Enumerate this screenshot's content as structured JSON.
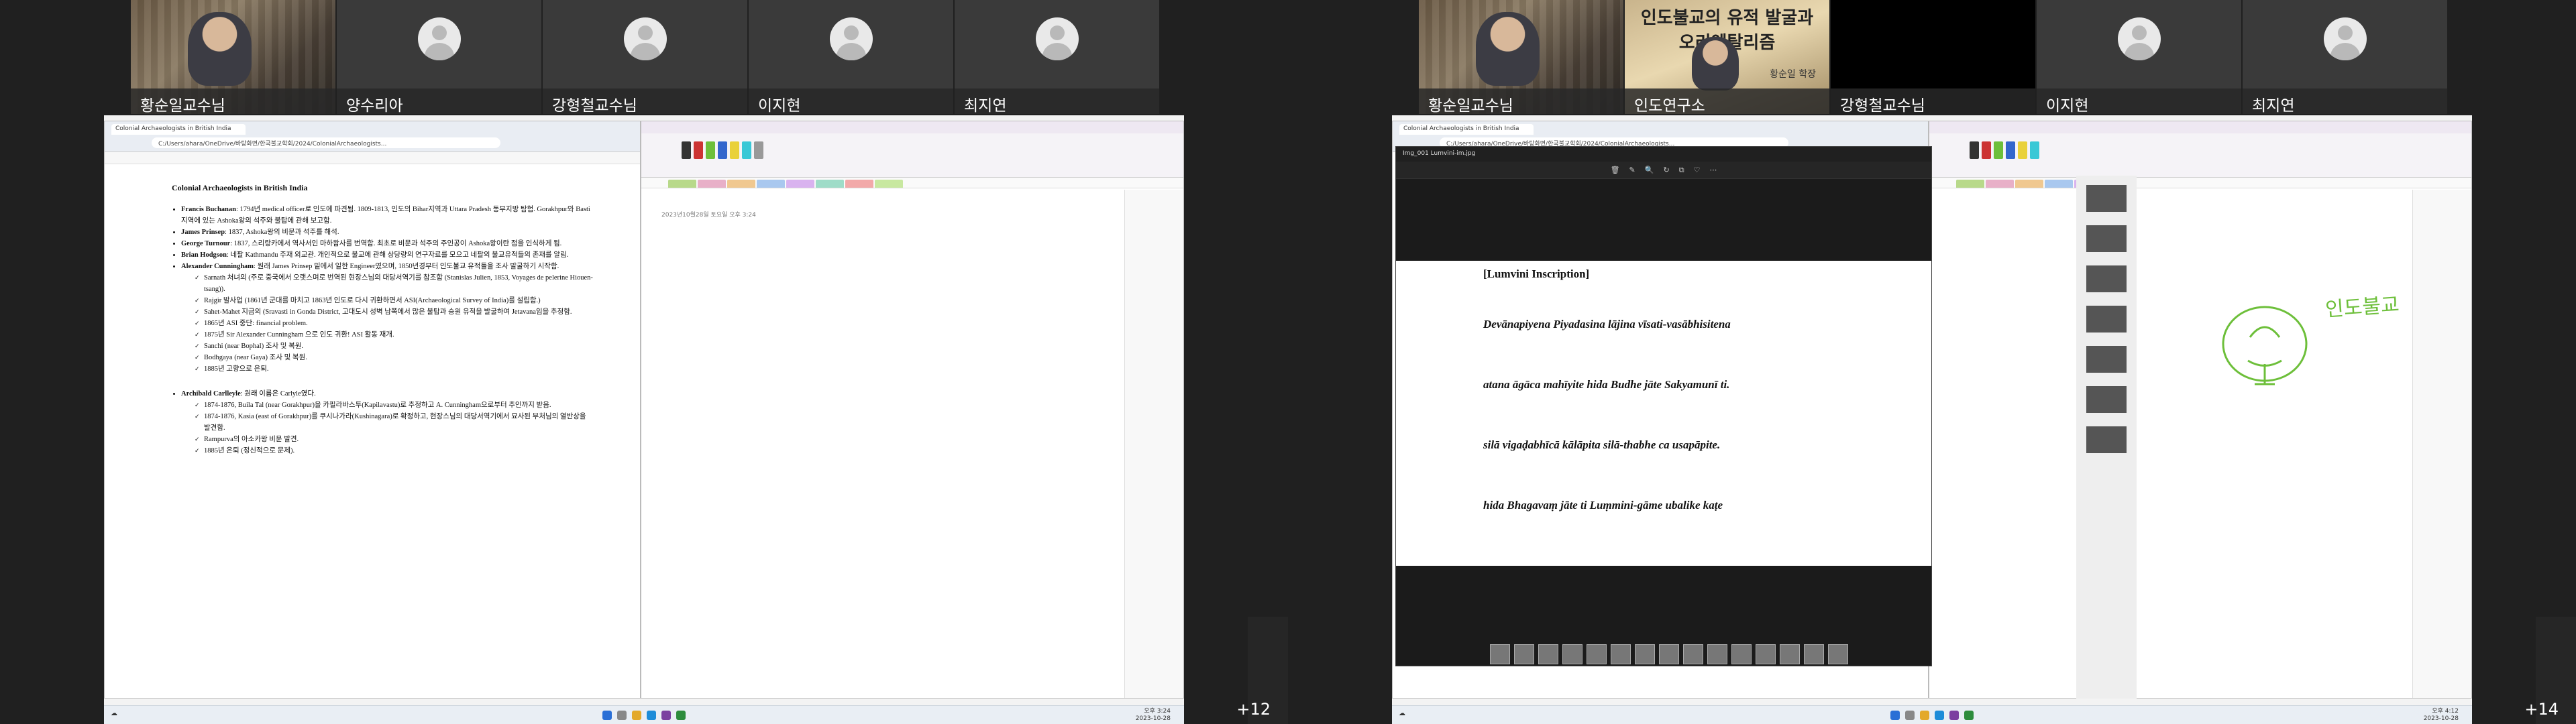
{
  "left": {
    "participants": [
      {
        "name": "황순일교수님",
        "kind": "video"
      },
      {
        "name": "양수리아",
        "kind": "avatar"
      },
      {
        "name": "강형철교수님",
        "kind": "avatar"
      },
      {
        "name": "이지현",
        "kind": "avatar"
      },
      {
        "name": "최지연",
        "kind": "avatar"
      }
    ],
    "browser": {
      "tab_title": "Colonial Archaeologists in British India",
      "url": "C:/Users/ahara/OneDrive/바탕화면/한국불교학회/2024/ColonialArchaeologists..."
    },
    "doc": {
      "title": "Colonial Archaeologists in British India",
      "items": [
        {
          "bold": "Francis Buchanan",
          "text": ": 1794년 medical officer로 인도에 파견됨. 1809-1813, 인도의 Bihar지역과 Uttara Pradesh 동부지방 탐험. Gorakhpur와 Basti 지역에 있는 Ashoka왕의 석주와 불탑에 관해 보고함."
        },
        {
          "bold": "James Prinsep",
          "text": ": 1837, Ashoka왕의 비문과 석주를 해석."
        },
        {
          "bold": "George Turnour",
          "text": ": 1837, 스리랑카에서 역사서인 마하왐사를 번역함. 최초로 비문과 석주의 주인공이 Ashoka왕이란 점을 인식하게 됨."
        },
        {
          "bold": "Brian Hodgson",
          "text": ": 네팔 Kathmandu 주재 외교관. 개인적으로 불교에 관해 상당량의 연구자료를 모으고 네팔의 불교유적들의 존재를 알림."
        },
        {
          "bold": "Alexander Cunningham",
          "text": ": 원래 James Prinsep 밑에서 일한 Engineer였으며, 1850년경부터 인도불교 유적들을 조사 발굴하기 시작함."
        }
      ],
      "sub_items": [
        "Sarnath 처녀의 (주로 중국에서 오랫스며로 번역된 현장스님의 대당서역기를 참조함 (Stanislas Julien, 1853, Voyages de pelerine Hiouen-tsang)).",
        "Rajgir 발사업 (1861년 군대를 마치고 1863년 인도로 다시 귀환하면서 ASI(Archaeological Survey of India)를 설립함.)",
        "Sahet-Mahet 지금의 (Sravasti in Gonda District, 고대도시 성벽 남쪽에서 많은 불탑과 승원 유적을 발굴하여 Jetavana임을 추정함.",
        "1865년 ASI 중단: financial problem.",
        "1875년 Sir Alexander Cunningham 으로 인도 귀환! ASI 활동 재개.",
        "Sanchi (near Bophal) 조사 및 복원.",
        "Bodhgaya (near Gaya) 조사 및 복원.",
        "1885년 고향으로 은퇴."
      ],
      "item2_bold": "Archibald Carlleyle",
      "item2_text": ": 원래 이름은 Carlyle였다.",
      "sub_items2": [
        "1874-1876, Buila Tal (near Gorakhpur)을 카필라바스투(Kapilavastu)로 추정하고 A. Cunningham으로부터 추인까지 받음.",
        "1874-1876, Kasia (east of Gorakhpur)를 쿠시나가라(Kushinagara)로 확정하고, 현장스님의 대당서역기에서 묘사된 부처님의 열반상을 발견함.",
        "Rampurva의 아소카왕 비문 발견.",
        "1885년 은퇴 (정신적으로 문제)."
      ]
    },
    "notes_date": "2023년10월28일 토요일   오후 3:24",
    "taskbar_time": "오후 3:24",
    "taskbar_date": "2023-10-28",
    "overflow_count": "+12"
  },
  "right": {
    "participants": [
      {
        "name": "황순일교수님",
        "kind": "video"
      },
      {
        "name": "인도연구소",
        "kind": "slide"
      },
      {
        "name": "강형철교수님",
        "kind": "dark"
      },
      {
        "name": "이지현",
        "kind": "avatar"
      },
      {
        "name": "최지연",
        "kind": "avatar"
      }
    ],
    "slide": {
      "title_line1": "인도불교의 유적 발굴과",
      "title_line2": "오리엔탈리즘",
      "presenter": "황순일 학장"
    },
    "viewer": {
      "title": "Img_001 Lumvini-im.jpg",
      "header": "[Lumvini Inscription]",
      "lines": [
        "Devānapiyena Piyadasina lājina vīsati-vasābhisitena",
        "atana āgāca mahīyite hida Budhe jāte Sakyamunī ti.",
        "silā vigaḍabhīcā kālāpita silā-thabhe ca usapāpite.",
        "hida Bhagavaṃ jāte ti Luṃmini-gāme ubalike kaṭe"
      ],
      "tool_icons": [
        "🗑",
        "✎",
        "🔍",
        "↻",
        "⧉",
        "♡",
        "⋯"
      ]
    },
    "handwriting": "인도불교",
    "taskbar_time": "오후 4:12",
    "taskbar_date": "2023-10-28",
    "overflow_count": "+14"
  },
  "colors": {
    "ink_green": "#6dbf3a",
    "onenote_purple": "#7b3fa0",
    "viewer_bg": "#1b1b1b"
  }
}
